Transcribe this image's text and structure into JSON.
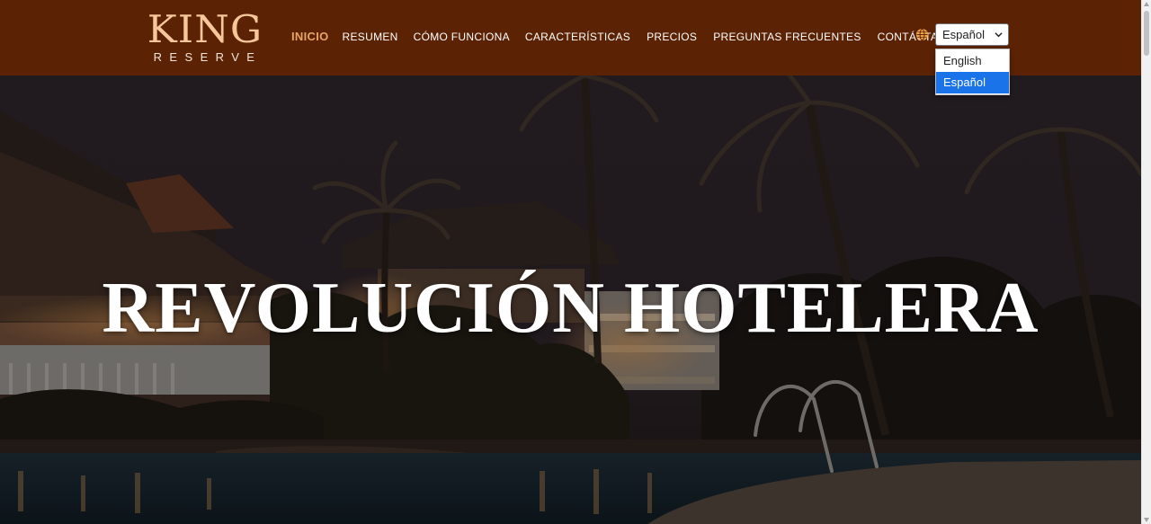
{
  "brand": {
    "name": "KING",
    "tagline": "RESERVE"
  },
  "nav": {
    "items": [
      {
        "label": "INICIO",
        "active": true
      },
      {
        "label": "RESUMEN",
        "active": false
      },
      {
        "label": "CÓMO FUNCIONA",
        "active": false
      },
      {
        "label": "CARACTERÍSTICAS",
        "active": false
      },
      {
        "label": "PRECIOS",
        "active": false
      },
      {
        "label": "PREGUNTAS FRECUENTES",
        "active": false
      },
      {
        "label": "CONTÁCTANOS",
        "active": false
      }
    ]
  },
  "language": {
    "icon": "globe-icon",
    "selected": "Español",
    "options": [
      "English",
      "Español"
    ]
  },
  "hero": {
    "title": "REVOLUCIÓN HOTELERA"
  },
  "colors": {
    "header_bg": "#5b2204",
    "logo": "#f7c79c",
    "nav_active": "#e8a466",
    "nav_text": "#ffffff",
    "option_highlight": "#1a73e8"
  }
}
